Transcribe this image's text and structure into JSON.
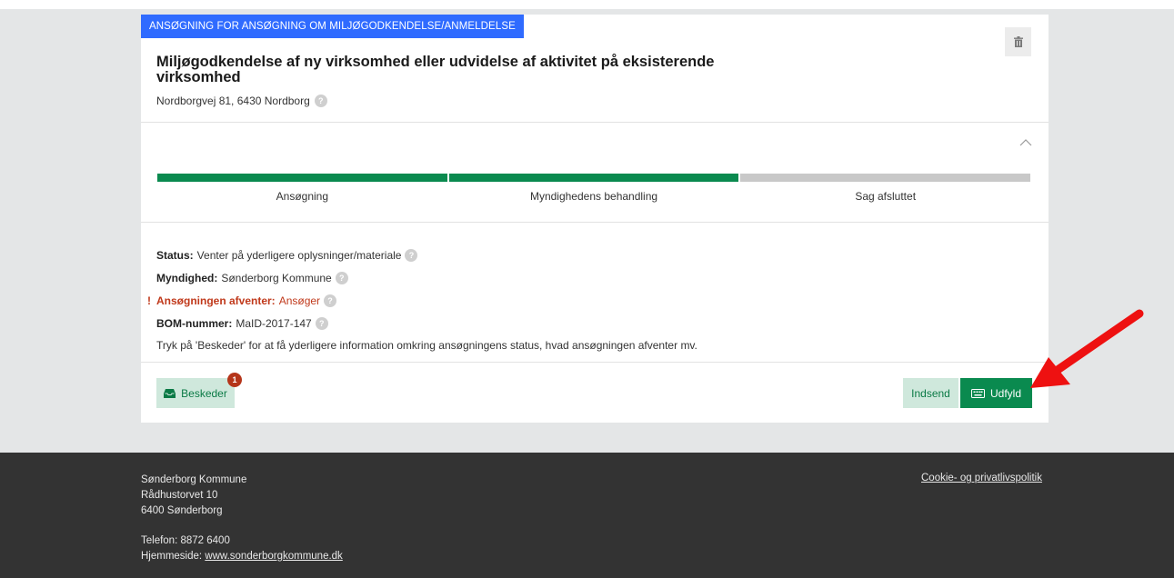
{
  "card": {
    "type_badge": "ANSØGNING FOR ANSØGNING OM MILJØGODKENDELSE/ANMELDELSE",
    "title": "Miljøgodkendelse af ny virksomhed eller udvidelse af aktivitet på eksisterende virksomhed",
    "address": "Nordborgvej 81, 6430 Nordborg"
  },
  "progress": {
    "steps": [
      {
        "label": "Ansøgning",
        "done": true
      },
      {
        "label": "Myndighedens behandling",
        "done": true
      },
      {
        "label": "Sag afsluttet",
        "done": false
      }
    ]
  },
  "info": {
    "status_label": "Status:",
    "status_value": "Venter på yderligere oplysninger/materiale",
    "authority_label": "Myndighed:",
    "authority_value": "Sønderborg Kommune",
    "alert_mark": "!",
    "awaiting_label": "Ansøgningen afventer:",
    "awaiting_value": "Ansøger",
    "bom_label": "BOM-nummer:",
    "bom_value": "MaID-2017-147",
    "note": "Tryk på 'Beskeder' for at få yderligere information omkring ansøgningens status, hvad ansøgningen afventer mv."
  },
  "actions": {
    "messages_label": "Beskeder",
    "messages_count": "1",
    "submit_label": "Indsend",
    "fill_label": "Udfyld"
  },
  "help_glyph": "?",
  "footer": {
    "org": "Sønderborg Kommune",
    "street": "Rådhustorvet 10",
    "city": "6400 Sønderborg",
    "phone": "Telefon: 8872 6400",
    "website_prefix": "Hjemmeside:",
    "website": "www.sonderborgkommune.dk",
    "privacy_link": "Cookie- og privatlivspolitik"
  },
  "colors": {
    "badge": "#2f6bff",
    "done": "#0a8a4f",
    "alert": "#c0391b",
    "annotation_arrow": "#ee1111"
  },
  "icons": [
    "trash-icon",
    "chevron-up-icon",
    "help-icon",
    "inbox-icon",
    "keyboard-icon",
    "annotation-arrow"
  ]
}
